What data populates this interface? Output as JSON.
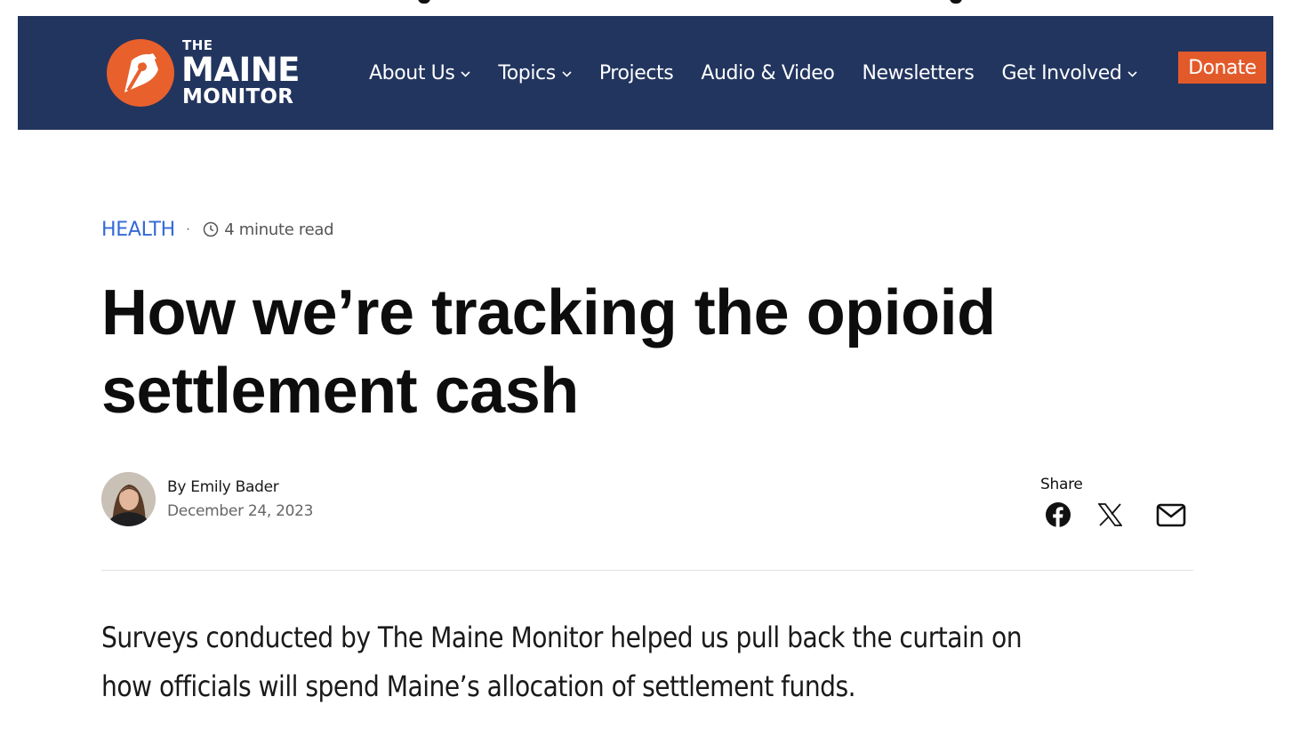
{
  "header": {
    "logo": {
      "line1": "THE",
      "line2": "MAINE",
      "line3": "MONITOR"
    },
    "nav": [
      {
        "label": "About Us",
        "dropdown": true
      },
      {
        "label": "Topics",
        "dropdown": true
      },
      {
        "label": "Projects",
        "dropdown": false
      },
      {
        "label": "Audio & Video",
        "dropdown": false
      },
      {
        "label": "Newsletters",
        "dropdown": false
      },
      {
        "label": "Get Involved",
        "dropdown": true
      }
    ],
    "donate_label": "Donate"
  },
  "article": {
    "category": "HEALTH",
    "read_time": "4 minute read",
    "title": "How we’re tracking the opioid settlement cash",
    "author": "By Emily Bader",
    "date": "December 24, 2023",
    "share_label": "Share",
    "dek": "Surveys conducted by The Maine Monitor helped us pull back the curtain on how officials will spend Maine’s allocation of settlement funds."
  },
  "icons": {
    "logo": "pen-nib-logo-icon",
    "clock": "clock-icon",
    "facebook": "facebook-icon",
    "x": "x-twitter-icon",
    "email": "envelope-icon",
    "chevron": "chevron-down-icon"
  },
  "colors": {
    "header_bg": "#22355f",
    "accent": "#e35a2a",
    "category": "#3569d8"
  }
}
